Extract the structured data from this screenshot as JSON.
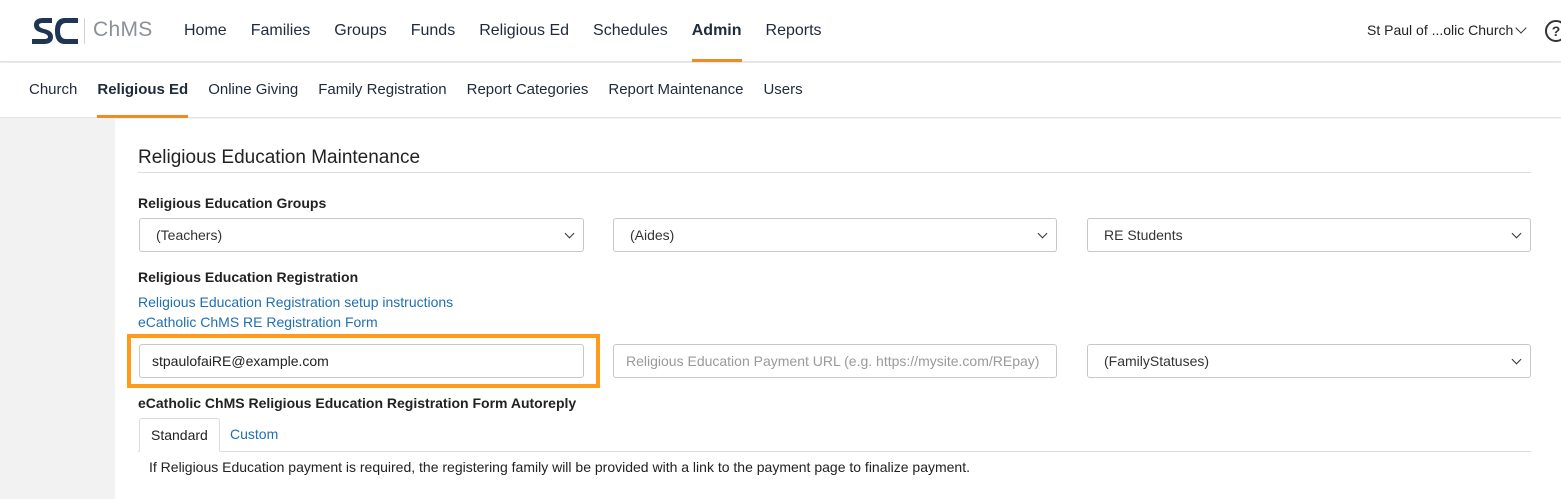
{
  "app": {
    "logo_text": "ChMS"
  },
  "topnav": {
    "items": [
      {
        "label": "Home"
      },
      {
        "label": "Families"
      },
      {
        "label": "Groups"
      },
      {
        "label": "Funds"
      },
      {
        "label": "Religious Ed"
      },
      {
        "label": "Schedules"
      },
      {
        "label": "Admin",
        "active": true
      },
      {
        "label": "Reports"
      }
    ],
    "church_name": "St Paul of ...olic Church",
    "help_symbol": "?"
  },
  "subnav": {
    "items": [
      {
        "label": "Church"
      },
      {
        "label": "Religious Ed",
        "active": true
      },
      {
        "label": "Online Giving"
      },
      {
        "label": "Family Registration"
      },
      {
        "label": "Report Categories"
      },
      {
        "label": "Report Maintenance"
      },
      {
        "label": "Users"
      }
    ]
  },
  "main": {
    "title": "Religious Education Maintenance",
    "groups_label": "Religious Education Groups",
    "groups_selects": [
      "(Teachers)",
      "(Aides)",
      "RE Students"
    ],
    "registration_label": "Religious Education Registration",
    "links": [
      "Religious Education Registration setup instructions",
      "eCatholic ChMS RE Registration Form"
    ],
    "email_value": "stpaulofaiRE@example.com",
    "payment_url_placeholder": "Religious Education Payment URL (e.g. https://mysite.com/REpay)",
    "family_status_select": "(FamilyStatuses)",
    "autoreply_label": "eCatholic ChMS Religious Education Registration Form Autoreply",
    "tabs": [
      {
        "label": "Standard",
        "active": true
      },
      {
        "label": "Custom"
      }
    ],
    "note": "If Religious Education payment is required, the registering family will be provided with a link to the payment page to finalize payment."
  },
  "colors": {
    "accent": "#f08a24",
    "highlight": "#ff9a1a",
    "link": "#1f6fb2",
    "brand": "#1f3553"
  },
  "icons": [
    "logo-icon",
    "chevron-down-icon",
    "help-icon",
    "caret-down-icon"
  ]
}
